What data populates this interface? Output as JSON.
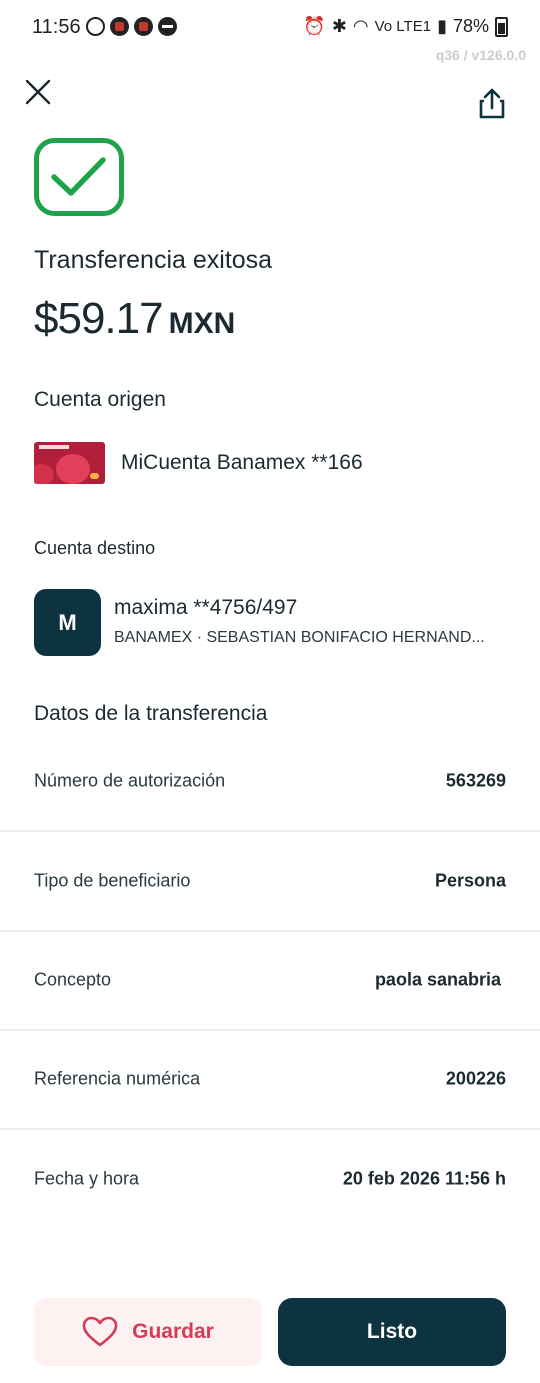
{
  "status_bar": {
    "time": "11:56",
    "network": "Vo LTE1",
    "battery": "78%"
  },
  "version": "q36 / v126.0.0",
  "header": {
    "close_icon": "close-icon",
    "share_icon": "share-icon"
  },
  "receipt": {
    "title": "Transferencia exitosa",
    "amount": "$59.17",
    "currency": "MXN",
    "success_color": "#1fa34a"
  },
  "origin": {
    "heading": "Cuenta origen",
    "account": "MiCuenta Banamex **166"
  },
  "destination": {
    "heading": "Cuenta destino",
    "avatar_initial": "M",
    "name": "maxima **4756/497",
    "detail": "BANAMEX · SEBASTIAN BONIFACIO HERNAND..."
  },
  "details": {
    "heading": "Datos de la transferencia",
    "rows": [
      {
        "label": "Número de autorización",
        "value": "563269"
      },
      {
        "label": "Tipo de beneficiario",
        "value": "Persona"
      },
      {
        "label": "Concepto",
        "value": "paola sanabria"
      },
      {
        "label": "Referencia numérica",
        "value": "200226"
      },
      {
        "label": "Fecha y hora",
        "value": "20 feb 2026 11:56 h"
      }
    ]
  },
  "actions": {
    "save_label": "Guardar",
    "done_label": "Listo",
    "primary_color": "#0d3340",
    "accent_color": "#d63b58"
  }
}
